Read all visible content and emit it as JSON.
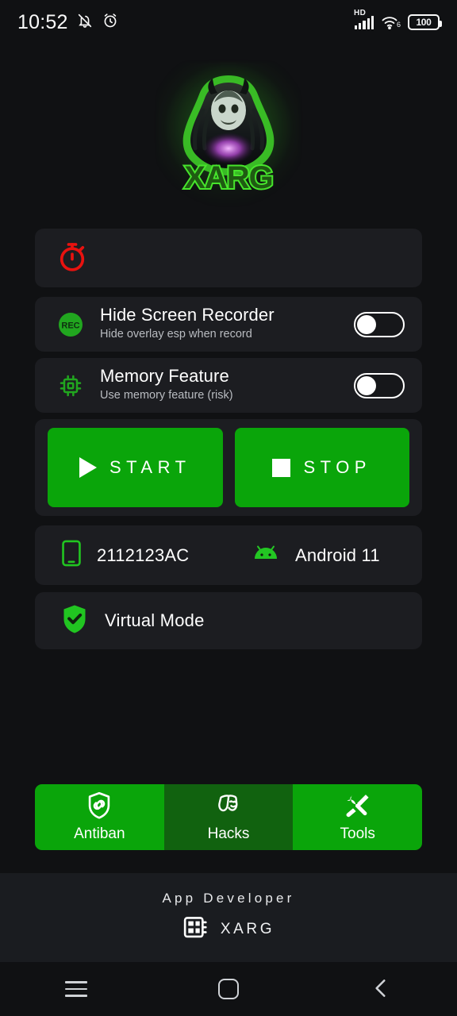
{
  "status_bar": {
    "time": "10:52",
    "icons_left": [
      "bell-off-icon",
      "alarm-clock-icon"
    ],
    "network_type": "HD",
    "signal_icon": "signal-bars-icon",
    "wifi_icon": "wifi-icon",
    "wifi_generation": "6",
    "battery_level": "100"
  },
  "logo": {
    "brand_text": "XARG",
    "icon": "xarg-predator-logo",
    "glow_color": "#3fd428"
  },
  "timer_card": {
    "icon": "stopwatch-icon",
    "icon_color": "#e8120f"
  },
  "settings": [
    {
      "icon": "rec-icon",
      "title": "Hide Screen Recorder",
      "subtitle": "Hide overlay esp when record",
      "toggle_state": "off"
    },
    {
      "icon": "cpu-chip-icon",
      "title": "Memory Feature",
      "subtitle": "Use memory feature (risk)",
      "toggle_state": "off"
    }
  ],
  "actions": {
    "start_label": "START",
    "start_icon": "play-icon",
    "stop_label": "STOP",
    "stop_icon": "stop-icon",
    "button_color": "#0aa50a"
  },
  "device": {
    "phone_icon": "phone-icon",
    "model": "2112123AC",
    "android_icon": "android-icon",
    "os_version": "Android 11"
  },
  "virtual_mode": {
    "icon": "shield-check-icon",
    "label": "Virtual Mode"
  },
  "tabs": [
    {
      "label": "Antiban",
      "icon": "shield-link-icon",
      "selected": false
    },
    {
      "label": "Hacks",
      "icon": "theater-masks-icon",
      "selected": true
    },
    {
      "label": "Tools",
      "icon": "tools-icon",
      "selected": false
    }
  ],
  "footer": {
    "title": "App Developer",
    "icon": "chip-board-icon",
    "developer_name": "XARG"
  },
  "navbar": {
    "recents": "recents-button",
    "home": "home-button",
    "back": "back-button"
  }
}
